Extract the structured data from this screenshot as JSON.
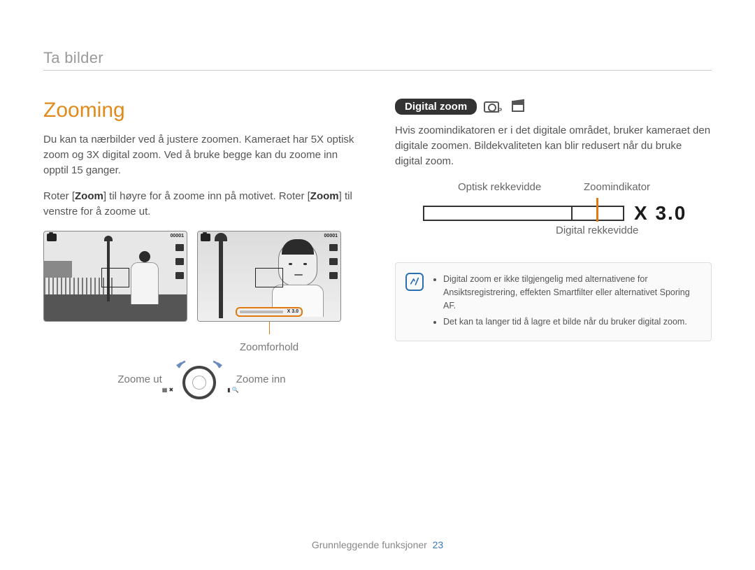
{
  "breadcrumb": "Ta bilder",
  "left": {
    "heading": "Zooming",
    "p1": "Du kan ta nærbilder ved å justere zoomen. Kameraet har 5X optisk zoom og 3X digital zoom. Ved å bruke begge kan du zoome inn opptil 15 ganger.",
    "p2_pre": "Roter [",
    "p2_bold1": "Zoom",
    "p2_mid": "] til høyre for å zoome inn på motivet. Roter [",
    "p2_bold2": "Zoom",
    "p2_post": "] til venstre for å zoome ut.",
    "shot_counter": "00001",
    "zoombar_text": "X 3.0",
    "zoomforhold": "Zoomforhold",
    "zoom_out": "Zoome ut",
    "zoom_in": "Zoome inn"
  },
  "right": {
    "pill": "Digital zoom",
    "p1": "Hvis zoomindikatoren er i det digitale området, bruker kameraet den digitale zoomen. Bildekvaliteten kan blir redusert når du bruke digital zoom.",
    "diag": {
      "optical": "Optisk rekkevidde",
      "indicator": "Zoomindikator",
      "digital": "Digital rekkevidde",
      "x30": "X 3.0"
    },
    "note1": "Digital zoom er ikke tilgjengelig med alternativene for Ansiktsregistrering, effekten Smartfilter eller alternativet Sporing AF.",
    "note2": "Det kan ta langer tid å lagre et bilde når du bruker digital zoom."
  },
  "footer": {
    "section": "Grunnleggende funksjoner",
    "page": "23"
  }
}
